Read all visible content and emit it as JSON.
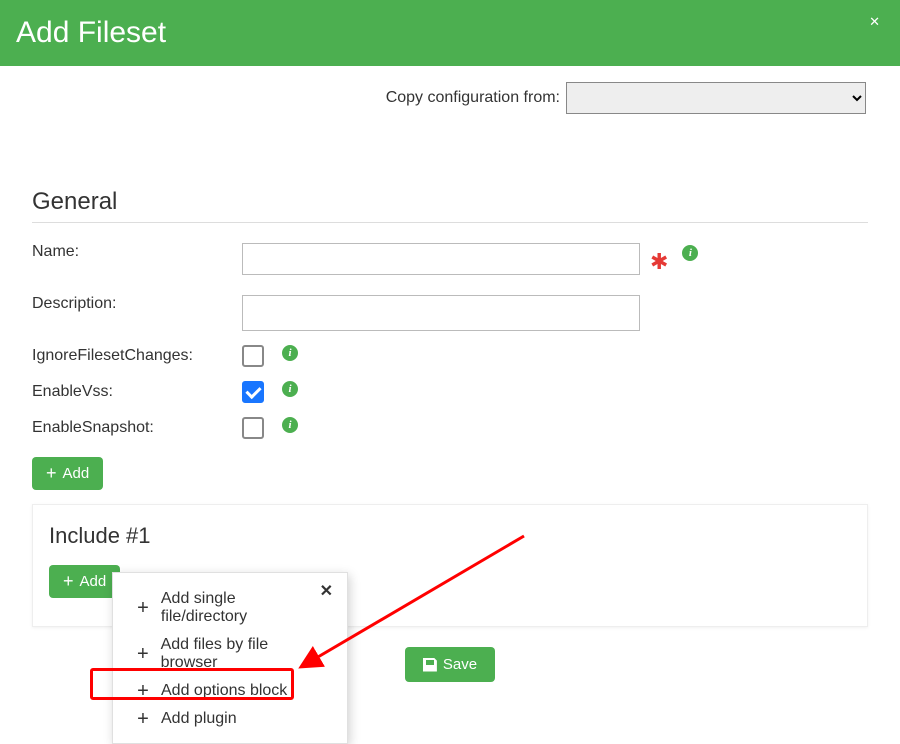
{
  "header": {
    "title": "Add Fileset"
  },
  "copy": {
    "label": "Copy configuration from:",
    "value": ""
  },
  "general": {
    "title": "General",
    "name_label": "Name:",
    "name_value": "",
    "desc_label": "Description:",
    "desc_value": "",
    "ignore_label": "IgnoreFilesetChanges:",
    "ignore_checked": false,
    "vss_label": "EnableVss:",
    "vss_checked": true,
    "snapshot_label": "EnableSnapshot:",
    "snapshot_checked": false,
    "add_label": "Add"
  },
  "include": {
    "title": "Include #1",
    "add_label": "Add",
    "menu": {
      "single": "Add single file/directory",
      "browser": "Add files by file browser",
      "options": "Add options block",
      "plugin": "Add plugin"
    }
  },
  "save_label": "Save"
}
